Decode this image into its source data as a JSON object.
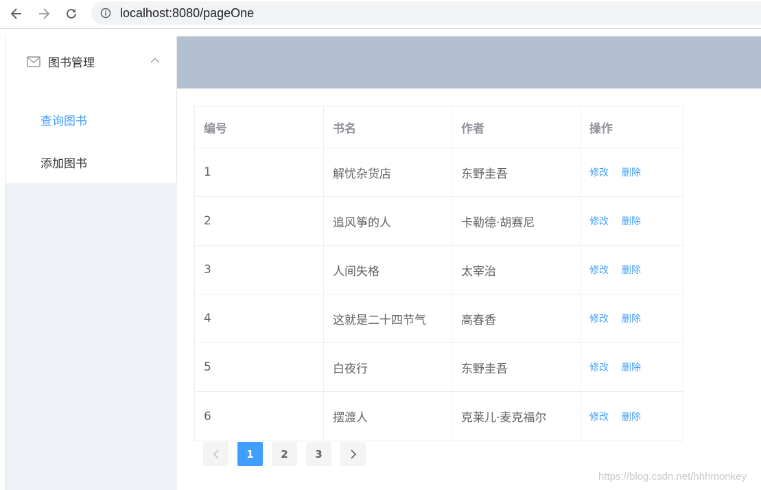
{
  "browser": {
    "url": "localhost:8080/pageOne"
  },
  "sidebar": {
    "submenu_title": "图书管理",
    "items": [
      {
        "label": "查询图书",
        "active": true
      },
      {
        "label": "添加图书",
        "active": false
      }
    ]
  },
  "table": {
    "headers": [
      "编号",
      "书名",
      "作者",
      "操作"
    ],
    "rows": [
      {
        "id": "1",
        "name": "解忧杂货店",
        "author": "东野圭吾"
      },
      {
        "id": "2",
        "name": "追风筝的人",
        "author": "卡勒德·胡赛尼"
      },
      {
        "id": "3",
        "name": "人间失格",
        "author": "太宰治"
      },
      {
        "id": "4",
        "name": "这就是二十四节气",
        "author": "高春香"
      },
      {
        "id": "5",
        "name": "白夜行",
        "author": "东野圭吾"
      },
      {
        "id": "6",
        "name": "摆渡人",
        "author": "克莱儿·麦克福尔"
      }
    ],
    "edit_label": "修改",
    "delete_label": "删除"
  },
  "pagination": {
    "pages": [
      "1",
      "2",
      "3"
    ],
    "current": "1"
  },
  "watermark": "https://blog.csdn.net/hhhmonkey",
  "colors": {
    "accent": "#409eff",
    "header_bg": "#b3c0d1",
    "sidebar_bg": "#eef1f6"
  }
}
